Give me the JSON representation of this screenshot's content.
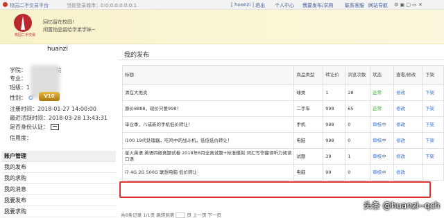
{
  "topbar": {
    "site_name": "校园二手交易平台",
    "city_label": "当前登录城市：0:0:0:0:0:0:0:1",
    "user_link": "[ huanzi ]",
    "logout": "退出",
    "nav": [
      "个人中心",
      "我要发布/求购",
      "联系客服",
      "网站导航"
    ]
  },
  "banner": {
    "logo_caption": "校园二手交易",
    "slogan1": "回忆留在校园!",
    "slogan2": "闲置物品留给学弟学妹~"
  },
  "profile": {
    "username": "huanzi",
    "school_label": "学院：",
    "school_value": "院",
    "major_label": "专业：",
    "class_label": "班级：",
    "class_value": "1",
    "gender_label": "性别：",
    "gender_icon": "♂",
    "reg_label": "注册时间：",
    "reg_value": "2018-01-27 14:00:00",
    "login_label": "最近活跃时间：",
    "login_value": "2018-03-28 13:43:31",
    "auth_label": "是否身份认证：",
    "credit_label": "信用度：",
    "credit_badge": "V10"
  },
  "menu": {
    "items": [
      "账户管理",
      "我的发布",
      "我的求购",
      "我的消息",
      "我要发布",
      "我要求购"
    ]
  },
  "main": {
    "title": "我的发布",
    "columns": [
      "标题",
      "商品类型",
      "转让价",
      "浏览次数",
      "状态",
      "查看/修改",
      "下架"
    ],
    "rows": [
      {
        "title": "清在大甩卖",
        "type": "球类",
        "price": "1",
        "views": "28",
        "status": "正常",
        "action": "修改",
        "off": "下架"
      },
      {
        "title": "原价8888，现价只要998！",
        "type": "二手车",
        "price": "998",
        "views": "65",
        "status": "正常",
        "action": "修改",
        "off": "下架"
      },
      {
        "title": "毕业季，八成新的手机低价转让！",
        "type": "手机",
        "price": "998",
        "views": "0",
        "status": "审核中",
        "action": "修改",
        "off": "下架"
      },
      {
        "title": "i100 19代处理器，吃鸡中的战斗机，低低低价转让！",
        "type": "电脑",
        "price": "998",
        "views": "0",
        "status": "审核中",
        "action": "修改",
        "off": "下架"
      },
      {
        "title": "星火英语 英语四级真题试卷 2018年6月全真试题+标准模拟 词汇写作翻译听力阅读口语",
        "type": "试题",
        "price": "39",
        "views": "1",
        "status": "审核中",
        "action": "修改",
        "off": "下架"
      },
      {
        "title": "i7 4G 2G 500G 联想电脑 低价转让",
        "type": "电脑",
        "price": "99",
        "views": "0",
        "status": "审核中",
        "action": "修改",
        "off": ""
      }
    ]
  },
  "pager": {
    "text": "共6条记录  1/1页  跳转到第",
    "suffix": "页  上一页  下一页"
  },
  "watermark": "头条 @huanzi--qch",
  "colors": {
    "highlight": "#e0302d",
    "status_ok": "#2e9e2e",
    "link": "#3b6fc9"
  }
}
